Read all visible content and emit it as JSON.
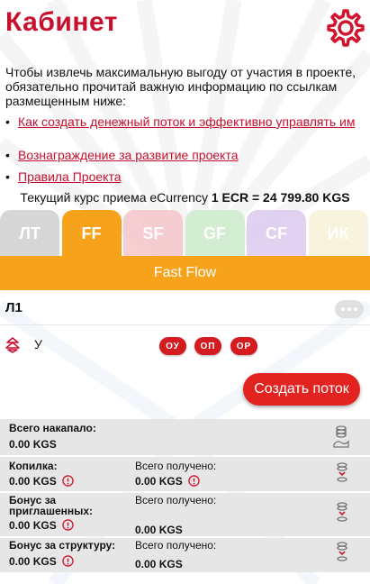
{
  "header": {
    "title": "Кабинет",
    "settings_icon": "gear-icon"
  },
  "intro": "Чтобы извлечь максимальную выгоду от участия в проекте, обязательно прочитай важную информацию по ссылкам размещенным ниже:",
  "links": [
    {
      "label": "Как создать денежный поток и эффективно управлять им"
    },
    {
      "label": "Вознаграждение за развитие проекта"
    },
    {
      "label": "Правила Проекта"
    }
  ],
  "rate": {
    "prefix": "Текущий курс приема eCurrency",
    "value": "1 ECR = 24 799.80 KGS"
  },
  "tabs": [
    {
      "label": "ЛТ",
      "color": "#cfcfcf"
    },
    {
      "label": "FF",
      "color": "#f7a21b",
      "active": true
    },
    {
      "label": "SF",
      "color": "#f6c7cb"
    },
    {
      "label": "GF",
      "color": "#cdeccd"
    },
    {
      "label": "CF",
      "color": "#dccbf0"
    },
    {
      "label": "ИК",
      "color": "#f6f2d6"
    }
  ],
  "band": {
    "label": "Fast Flow",
    "color": "#f7a21b"
  },
  "flow": {
    "level": "Л1",
    "more_icon": "more-horizontal-icon",
    "user_label": "У",
    "tree_icon": "tree-icon",
    "pills": [
      "ОУ",
      "ОП",
      "ОР"
    ],
    "create_button": "Создать поток"
  },
  "stats": {
    "total": {
      "label": "Всего накапало:",
      "value": "0.00 KGS"
    },
    "piggy": {
      "label": "Копилка:",
      "value": "0.00 KGS",
      "received_label": "Всего получено:",
      "received_value": "0.00 KGS"
    },
    "invited": {
      "label_1": "Бонус за",
      "label_2": "приглашенных:",
      "value": "0.00 KGS",
      "received_label": "Всего получено:",
      "received_value": "0.00 KGS"
    },
    "structure": {
      "label": "Бонус за структуру:",
      "value": "0.00 KGS",
      "received_label": "Всего получено:",
      "received_value": "0.00 KGS"
    }
  },
  "colors": {
    "accent": "#c8102e",
    "button": "#e32320",
    "orange": "#f7a21b",
    "stat_bg": "#e6e6e6"
  }
}
